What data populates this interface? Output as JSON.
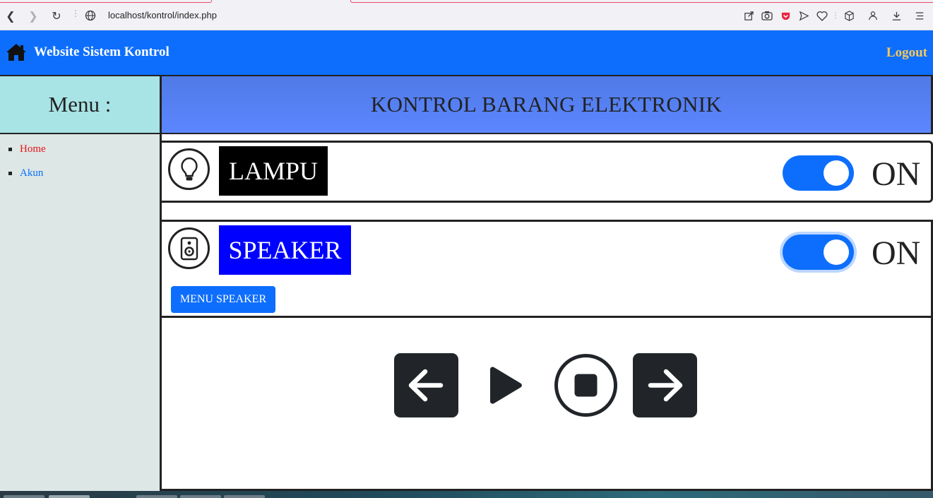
{
  "browser": {
    "url": "localhost/kontrol/index.php",
    "icons": [
      "back-icon",
      "forward-icon",
      "reload-icon",
      "site-info-icon",
      "share-icon",
      "camera-icon",
      "pocket-icon",
      "send-icon",
      "heart-icon",
      "box-icon",
      "profile-icon",
      "download-icon",
      "menu-icon"
    ]
  },
  "navbar": {
    "brand": "Website Sistem Kontrol",
    "logout": "Logout",
    "color": "#0d6efd",
    "logout_color": "#f5c85a"
  },
  "sidebar": {
    "heading": "Menu :",
    "items": [
      {
        "label": "Home",
        "color": "#e8121a"
      },
      {
        "label": "Akun",
        "color": "#0d6efd"
      }
    ]
  },
  "main": {
    "heading": "KONTROL BARANG ELEKTRONIK",
    "devices": [
      {
        "name": "LAMPU",
        "icon": "lightbulb-icon",
        "label_bg": "#000000",
        "toggle_on": true,
        "state": "ON"
      },
      {
        "name": "SPEAKER",
        "icon": "speaker-icon",
        "label_bg": "#0000ff",
        "toggle_on": true,
        "state": "ON",
        "button": "MENU SPEAKER"
      }
    ],
    "player_controls": [
      "previous-icon",
      "play-icon",
      "stop-icon",
      "next-icon"
    ]
  }
}
